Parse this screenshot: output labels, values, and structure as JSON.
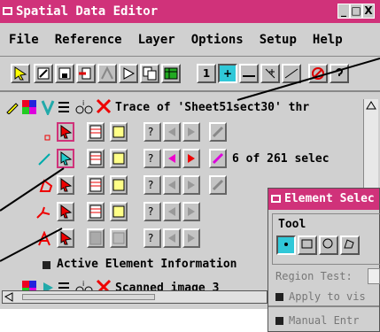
{
  "window": {
    "title": "Spatial Data Editor",
    "buttons": [
      "_",
      "□",
      "X"
    ]
  },
  "menu": [
    "File",
    "Reference",
    "Layer",
    "Options",
    "Setup",
    "Help"
  ],
  "toolbar": {
    "snap_labels": [
      "1",
      "+",
      "",
      "+",
      ""
    ]
  },
  "layers": {
    "trace_label": "Trace of 'Sheet51sect30' thr",
    "selection_count": "6 of 261 selec",
    "active_info": "Active Element Information",
    "scanned_label": "Scanned image_3"
  },
  "dialog": {
    "title": "Element Selec",
    "tool_label": "Tool",
    "region_test": "Region Test:",
    "apply": "Apply to vis",
    "manual": "Manual Entr"
  },
  "colors": {
    "titlebar": "#d0327a",
    "panel": "#d0d0d0",
    "active_tool": "#30c8d8"
  }
}
